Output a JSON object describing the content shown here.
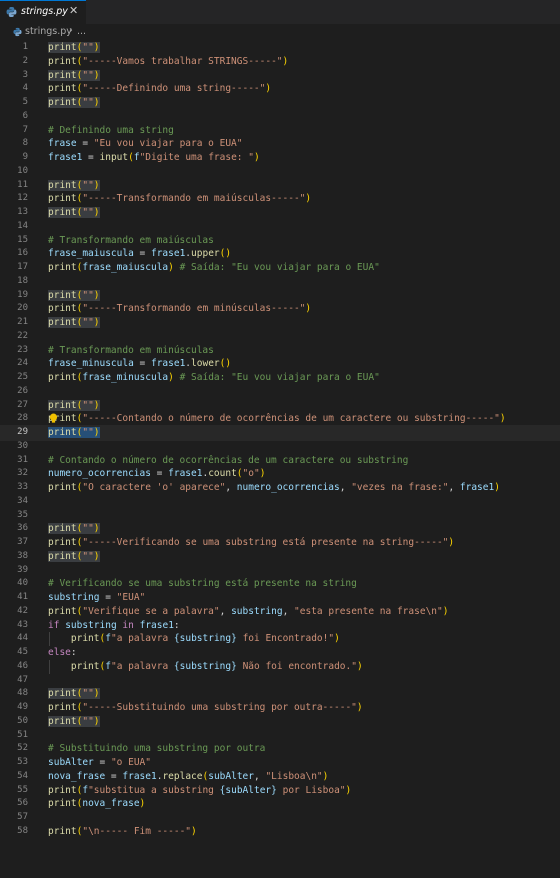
{
  "tab": {
    "filename": "strings.py",
    "close": "✕",
    "icon": "python-icon"
  },
  "breadcrumb": {
    "file": "strings.py",
    "separator": "›",
    "rest": "..."
  },
  "lines": [
    {
      "n": "1"
    },
    {
      "n": "2"
    },
    {
      "n": "3"
    },
    {
      "n": "4"
    },
    {
      "n": "5"
    },
    {
      "n": "6"
    },
    {
      "n": "7"
    },
    {
      "n": "8"
    },
    {
      "n": "9"
    },
    {
      "n": "10"
    },
    {
      "n": "11"
    },
    {
      "n": "12"
    },
    {
      "n": "13"
    },
    {
      "n": "14"
    },
    {
      "n": "15"
    },
    {
      "n": "16"
    },
    {
      "n": "17"
    },
    {
      "n": "18"
    },
    {
      "n": "19"
    },
    {
      "n": "20"
    },
    {
      "n": "21"
    },
    {
      "n": "22"
    },
    {
      "n": "23"
    },
    {
      "n": "24"
    },
    {
      "n": "25"
    },
    {
      "n": "26"
    },
    {
      "n": "27"
    },
    {
      "n": "28"
    },
    {
      "n": "29"
    },
    {
      "n": "30"
    },
    {
      "n": "31"
    },
    {
      "n": "32"
    },
    {
      "n": "33"
    },
    {
      "n": "34"
    },
    {
      "n": "35"
    },
    {
      "n": "36"
    },
    {
      "n": "37"
    },
    {
      "n": "38"
    },
    {
      "n": "39"
    },
    {
      "n": "40"
    },
    {
      "n": "41"
    },
    {
      "n": "42"
    },
    {
      "n": "43"
    },
    {
      "n": "44"
    },
    {
      "n": "45"
    },
    {
      "n": "46"
    },
    {
      "n": "47"
    },
    {
      "n": "48"
    },
    {
      "n": "49"
    },
    {
      "n": "50"
    },
    {
      "n": "51"
    },
    {
      "n": "52"
    },
    {
      "n": "53"
    },
    {
      "n": "54"
    },
    {
      "n": "55"
    },
    {
      "n": "56"
    },
    {
      "n": "57"
    },
    {
      "n": "58"
    }
  ],
  "code": {
    "print": "print",
    "empty": "\"\"",
    "l2": "\"-----Vamos trabalhar STRINGS-----\"",
    "l4": "\"-----Definindo uma string-----\"",
    "c7": "# Definindo uma string",
    "l8_var": "frase",
    "l8_str": "\"Eu vou viajar para o EUA\"",
    "l9_var": "frase1",
    "l9_fn": "input",
    "l9_f": "f",
    "l9_str": "\"Digite uma frase: \"",
    "l12": "\"-----Transformando em maiúsculas-----\"",
    "c15": "# Transformando em maiúsculas",
    "l16_var": "frase_maiuscula",
    "l16_obj": "frase1",
    "l16_fn": "upper",
    "l17_arg": "frase_maiuscula",
    "l17_cmt": "# Saída: \"Eu vou viajar para o EUA\"",
    "l20": "\"-----Transformando em minúsculas-----\"",
    "c23": "# Transformando em minúsculas",
    "l24_var": "frase_minuscula",
    "l24_obj": "frase1",
    "l24_fn": "lower",
    "l25_arg": "frase_minuscula",
    "l25_cmt": "# Saída: \"Eu vou viajar para o EUA\"",
    "l28_p": "p",
    "l28_rint": "rint",
    "l28": "\"-----Contando o número de ocorrências de um caractere ou substring-----\"",
    "c31": "# Contando o número de ocorrências de um caractere ou substring",
    "l32_var": "numero_ocorrencias",
    "l32_obj": "frase1",
    "l32_fn": "count",
    "l32_str": "\"o\"",
    "l33_s1": "\"O caractere 'o' aparece\"",
    "l33_v": "numero_ocorrencias",
    "l33_s2": "\"vezes na frase:\"",
    "l33_v2": "frase1",
    "l37": "\"-----Verificando se uma substring está presente na string-----\"",
    "c40": "# Verificando se uma substring está presente na string",
    "l41_var": "substring",
    "l41_str": "\"EUA\"",
    "l42_s1": "\"Verifique se a palavra\"",
    "l42_v": "substring",
    "l42_s2": "\"esta presente na frase\\n\"",
    "if": "if",
    "in": "in",
    "l43_v1": "substring",
    "l43_v2": "frase1",
    "f": "f",
    "l44_s1": "\"a palavra ",
    "l44_v": "substring",
    "l44_s2": " foi Encontrado!\"",
    "else": "else",
    "l46_s1": "\"a palavra ",
    "l46_v": "substring",
    "l46_s2": " Não foi encontrado.\"",
    "l49": "\"-----Substituindo uma substring por outra-----\"",
    "c52": "# Substituindo uma substring por outra",
    "l53_var": "subAlter",
    "l53_str": "\"o EUA\"",
    "l54_var": "nova_frase",
    "l54_obj": "frase1",
    "l54_fn": "replace",
    "l54_arg": "subAlter",
    "l54_str": "\"Lisboa\\n\"",
    "l55_s1": "\"substitua a substring ",
    "l55_v": "subAlter",
    "l55_s2": " por Lisboa\"",
    "l56_arg": "nova_frase",
    "l58": "\"\\n----- Fim -----\""
  }
}
